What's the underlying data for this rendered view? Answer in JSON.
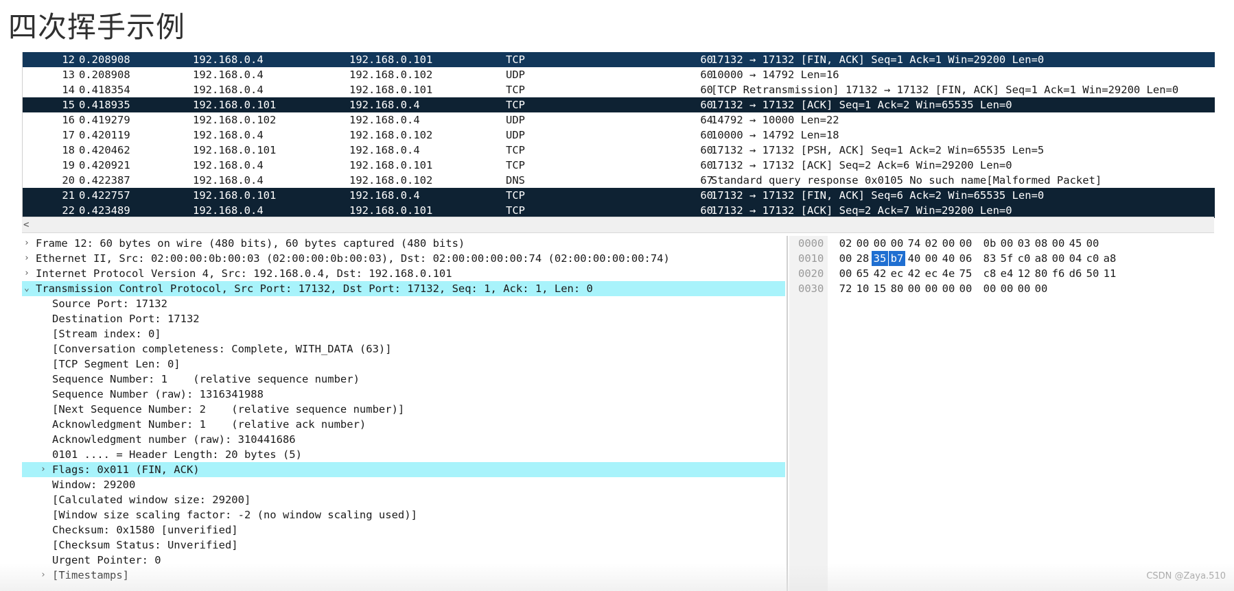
{
  "page_title": "四次挥手示例",
  "packets": [
    {
      "no": "12",
      "time": "0.208908",
      "src": "192.168.0.4",
      "dst": "192.168.0.101",
      "proto": "TCP",
      "len": "60",
      "info": "17132 → 17132 [FIN, ACK] Seq=1 Ack=1 Win=29200 Len=0",
      "style": "sel"
    },
    {
      "no": "13",
      "time": "0.208908",
      "src": "192.168.0.4",
      "dst": "192.168.0.102",
      "proto": "UDP",
      "len": "60",
      "info": "10000 → 14792 Len=16",
      "style": ""
    },
    {
      "no": "14",
      "time": "0.418354",
      "src": "192.168.0.4",
      "dst": "192.168.0.101",
      "proto": "TCP",
      "len": "60",
      "info": "[TCP Retransmission] 17132 → 17132 [FIN, ACK] Seq=1 Ack=1 Win=29200 Len=0",
      "style": ""
    },
    {
      "no": "15",
      "time": "0.418935",
      "src": "192.168.0.101",
      "dst": "192.168.0.4",
      "proto": "TCP",
      "len": "60",
      "info": "17132 → 17132 [ACK] Seq=1 Ack=2 Win=65535 Len=0",
      "style": "dark"
    },
    {
      "no": "16",
      "time": "0.419279",
      "src": "192.168.0.102",
      "dst": "192.168.0.4",
      "proto": "UDP",
      "len": "64",
      "info": "14792 → 10000 Len=22",
      "style": ""
    },
    {
      "no": "17",
      "time": "0.420119",
      "src": "192.168.0.4",
      "dst": "192.168.0.102",
      "proto": "UDP",
      "len": "60",
      "info": "10000 → 14792 Len=18",
      "style": ""
    },
    {
      "no": "18",
      "time": "0.420462",
      "src": "192.168.0.101",
      "dst": "192.168.0.4",
      "proto": "TCP",
      "len": "60",
      "info": "17132 → 17132 [PSH, ACK] Seq=1 Ack=2 Win=65535 Len=5",
      "style": ""
    },
    {
      "no": "19",
      "time": "0.420921",
      "src": "192.168.0.4",
      "dst": "192.168.0.101",
      "proto": "TCP",
      "len": "60",
      "info": "17132 → 17132 [ACK] Seq=2 Ack=6 Win=29200 Len=0",
      "style": ""
    },
    {
      "no": "20",
      "time": "0.422387",
      "src": "192.168.0.4",
      "dst": "192.168.0.102",
      "proto": "DNS",
      "len": "67",
      "info": "Standard query response 0x0105 No such name[Malformed Packet]",
      "style": ""
    },
    {
      "no": "21",
      "time": "0.422757",
      "src": "192.168.0.101",
      "dst": "192.168.0.4",
      "proto": "TCP",
      "len": "60",
      "info": "17132 → 17132 [FIN, ACK] Seq=6 Ack=2 Win=65535 Len=0",
      "style": "dark"
    },
    {
      "no": "22",
      "time": "0.423489",
      "src": "192.168.0.4",
      "dst": "192.168.0.101",
      "proto": "TCP",
      "len": "60",
      "info": "17132 → 17132 [ACK] Seq=2 Ack=7 Win=29200 Len=0",
      "style": "dark"
    }
  ],
  "scroll_left_glyph": "<",
  "details": [
    {
      "level": 0,
      "expander": ">",
      "text": "Frame 12: 60 bytes on wire (480 bits), 60 bytes captured (480 bits)",
      "hl": false
    },
    {
      "level": 0,
      "expander": ">",
      "text": "Ethernet II, Src: 02:00:00:0b:00:03 (02:00:00:0b:00:03), Dst: 02:00:00:00:00:74 (02:00:00:00:00:74)",
      "hl": false
    },
    {
      "level": 0,
      "expander": ">",
      "text": "Internet Protocol Version 4, Src: 192.168.0.4, Dst: 192.168.0.101",
      "hl": false
    },
    {
      "level": 0,
      "expander": "v",
      "text": "Transmission Control Protocol, Src Port: 17132, Dst Port: 17132, Seq: 1, Ack: 1, Len: 0",
      "hl": true
    },
    {
      "level": 1,
      "expander": "",
      "text": "Source Port: 17132",
      "hl": false
    },
    {
      "level": 1,
      "expander": "",
      "text": "Destination Port: 17132",
      "hl": false
    },
    {
      "level": 1,
      "expander": "",
      "text": "[Stream index: 0]",
      "hl": false
    },
    {
      "level": 1,
      "expander": "",
      "text": "[Conversation completeness: Complete, WITH_DATA (63)]",
      "hl": false
    },
    {
      "level": 1,
      "expander": "",
      "text": "[TCP Segment Len: 0]",
      "hl": false
    },
    {
      "level": 1,
      "expander": "",
      "text": "Sequence Number: 1    (relative sequence number)",
      "hl": false
    },
    {
      "level": 1,
      "expander": "",
      "text": "Sequence Number (raw): 1316341988",
      "hl": false
    },
    {
      "level": 1,
      "expander": "",
      "text": "[Next Sequence Number: 2    (relative sequence number)]",
      "hl": false
    },
    {
      "level": 1,
      "expander": "",
      "text": "Acknowledgment Number: 1    (relative ack number)",
      "hl": false
    },
    {
      "level": 1,
      "expander": "",
      "text": "Acknowledgment number (raw): 310441686",
      "hl": false
    },
    {
      "level": 1,
      "expander": "",
      "text": "0101 .... = Header Length: 20 bytes (5)",
      "hl": false
    },
    {
      "level": 1,
      "expander": ">",
      "text": "Flags: 0x011 (FIN, ACK)",
      "hl": true
    },
    {
      "level": 1,
      "expander": "",
      "text": "Window: 29200",
      "hl": false
    },
    {
      "level": 1,
      "expander": "",
      "text": "[Calculated window size: 29200]",
      "hl": false
    },
    {
      "level": 1,
      "expander": "",
      "text": "[Window size scaling factor: -2 (no window scaling used)]",
      "hl": false
    },
    {
      "level": 1,
      "expander": "",
      "text": "Checksum: 0x1580 [unverified]",
      "hl": false
    },
    {
      "level": 1,
      "expander": "",
      "text": "[Checksum Status: Unverified]",
      "hl": false
    },
    {
      "level": 1,
      "expander": "",
      "text": "Urgent Pointer: 0",
      "hl": false
    },
    {
      "level": 1,
      "expander": ">",
      "text": "[Timestamps]",
      "hl": false
    }
  ],
  "hex_rows": [
    {
      "offset": "0000",
      "bytes": [
        "02",
        "00",
        "00",
        "00",
        "74",
        "02",
        "00",
        "00",
        "0b",
        "00",
        "03",
        "08",
        "00",
        "45",
        "00"
      ],
      "hi": []
    },
    {
      "offset": "0010",
      "bytes": [
        "00",
        "28",
        "35",
        "b7",
        "40",
        "00",
        "40",
        "06",
        "83",
        "5f",
        "c0",
        "a8",
        "00",
        "04",
        "c0",
        "a8"
      ],
      "hi": [
        2,
        3
      ]
    },
    {
      "offset": "0020",
      "bytes": [
        "00",
        "65",
        "42",
        "ec",
        "42",
        "ec",
        "4e",
        "75",
        "c8",
        "e4",
        "12",
        "80",
        "f6",
        "d6",
        "50",
        "11"
      ],
      "hi": []
    },
    {
      "offset": "0030",
      "bytes": [
        "72",
        "10",
        "15",
        "80",
        "00",
        "00",
        "00",
        "00",
        "00",
        "00",
        "00",
        "00"
      ],
      "hi": []
    }
  ],
  "watermark": "CSDN @Zaya.510"
}
